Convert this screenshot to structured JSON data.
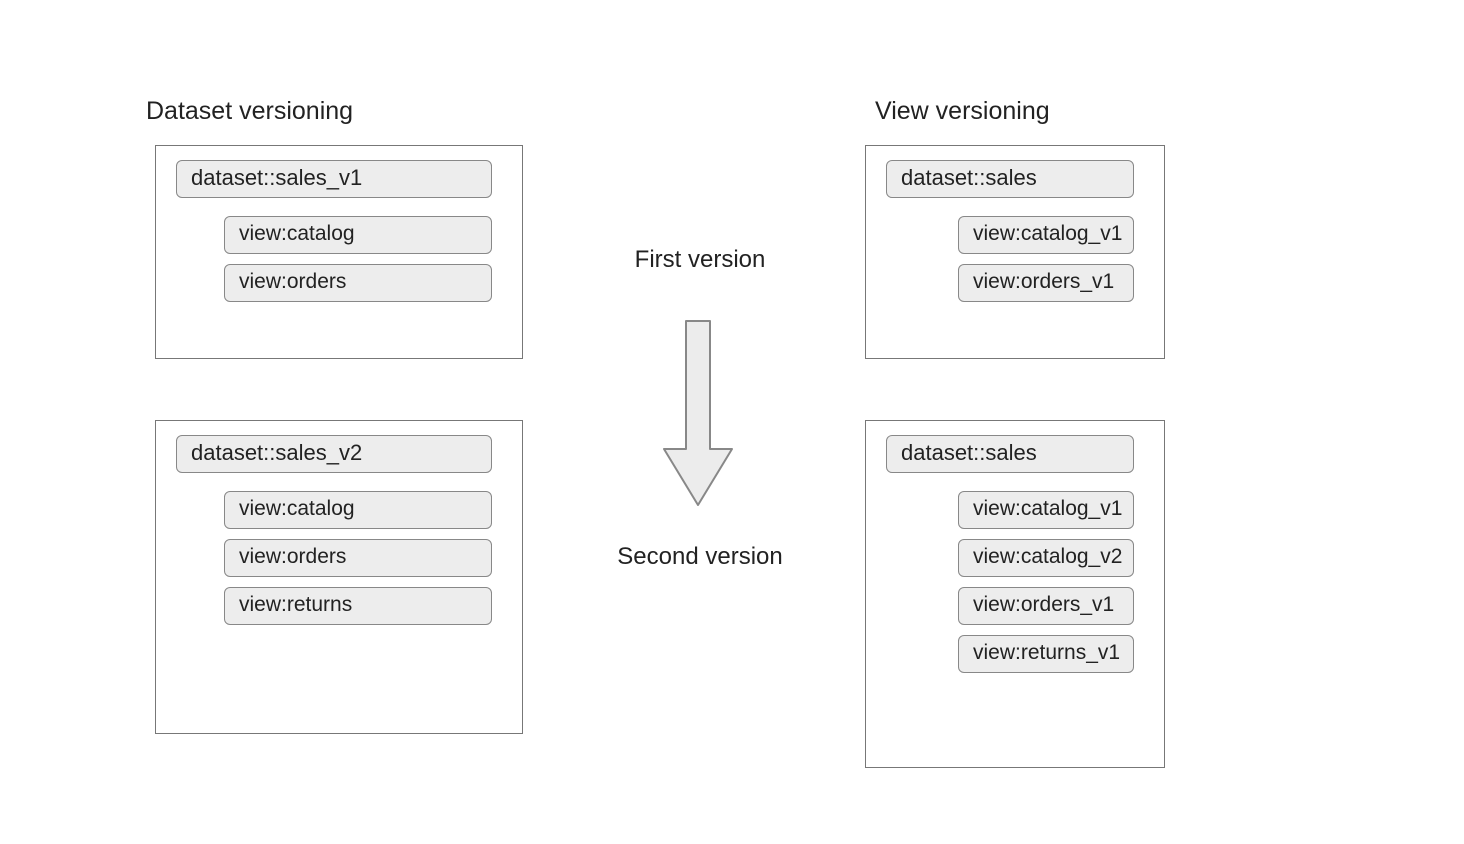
{
  "titles": {
    "left": "Dataset versioning",
    "right": "View versioning"
  },
  "center": {
    "first": "First version",
    "second": "Second version"
  },
  "left": {
    "first": {
      "dataset": "dataset::sales_v1",
      "views": [
        "view:catalog",
        "view:orders"
      ]
    },
    "second": {
      "dataset": "dataset::sales_v2",
      "views": [
        "view:catalog",
        "view:orders",
        "view:returns"
      ]
    }
  },
  "right": {
    "first": {
      "dataset": "dataset::sales",
      "views": [
        "view:catalog_v1",
        "view:orders_v1"
      ]
    },
    "second": {
      "dataset": "dataset::sales",
      "views": [
        "view:catalog_v1",
        "view:catalog_v2",
        "view:orders_v1",
        "view:returns_v1"
      ]
    }
  }
}
